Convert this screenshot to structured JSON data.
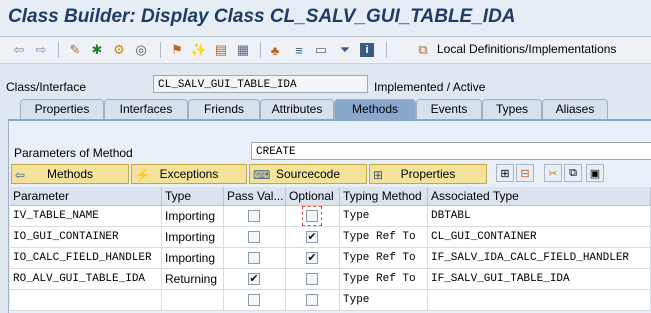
{
  "window": {
    "title": "Class Builder: Display Class CL_SALV_GUI_TABLE_IDA"
  },
  "toolbar": {
    "icons": [
      "back-arrow-icon",
      "forward-arrow-icon",
      "other-object-icon",
      "display-change-icon",
      "activate-icon",
      "where-used-icon",
      "hierarchy-icon",
      "magic-wand-icon",
      "layout-icon",
      "tree-icon",
      "sort-icon",
      "filter-icon",
      "info-icon",
      "local-definitions-icon"
    ],
    "local_definitions_label": "Local Definitions/Implementations"
  },
  "class": {
    "label": "Class/Interface",
    "value": "CL_SALV_GUI_TABLE_IDA",
    "status": "Implemented / Active"
  },
  "tabs": [
    {
      "label": "Properties"
    },
    {
      "label": "Interfaces"
    },
    {
      "label": "Friends"
    },
    {
      "label": "Attributes"
    },
    {
      "label": "Methods",
      "active": true
    },
    {
      "label": "Events"
    },
    {
      "label": "Types"
    },
    {
      "label": "Aliases"
    }
  ],
  "parameters": {
    "label": "Parameters of Method",
    "method": "CREATE"
  },
  "nav_buttons": {
    "methods": "Methods",
    "exceptions": "Exceptions",
    "sourcecode": "Sourcecode",
    "properties": "Properties"
  },
  "table": {
    "columns": [
      "Parameter",
      "Type",
      "Pass Val...",
      "Optional",
      "Typing Method",
      "Associated Type"
    ],
    "rows": [
      {
        "parameter": "IV_TABLE_NAME",
        "type": "Importing",
        "pass_value": false,
        "optional": false,
        "typing": "Type",
        "assoc": "DBTABL"
      },
      {
        "parameter": "IO_GUI_CONTAINER",
        "type": "Importing",
        "pass_value": false,
        "optional": true,
        "typing": "Type Ref To",
        "assoc": "CL_GUI_CONTAINER"
      },
      {
        "parameter": "IO_CALC_FIELD_HANDLER",
        "type": "Importing",
        "pass_value": false,
        "optional": true,
        "typing": "Type Ref To",
        "assoc": "IF_SALV_IDA_CALC_FIELD_HANDLER"
      },
      {
        "parameter": "RO_ALV_GUI_TABLE_IDA",
        "type": "Returning",
        "pass_value": true,
        "optional": false,
        "typing": "Type Ref To",
        "assoc": "IF_SALV_GUI_TABLE_IDA"
      },
      {
        "parameter": "",
        "type": "",
        "pass_value": false,
        "optional": false,
        "typing": "Type",
        "assoc": ""
      }
    ]
  },
  "colors": {
    "accent": "#8aa8cc",
    "title": "#1d3c66",
    "button": "#f3e39a"
  }
}
